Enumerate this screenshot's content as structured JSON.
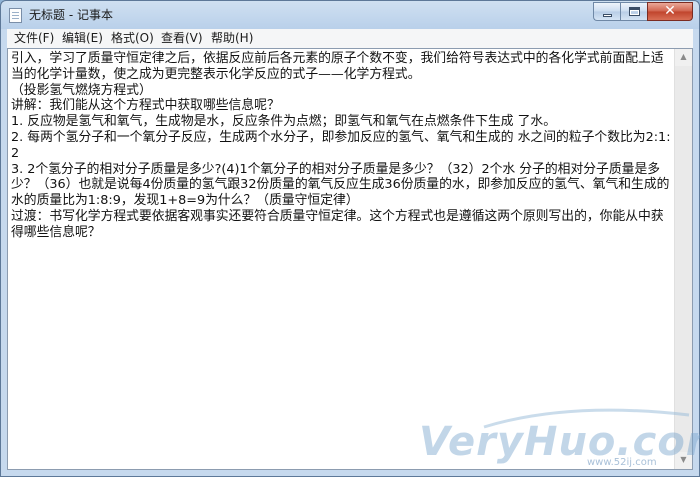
{
  "window": {
    "title": "无标题 - 记事本",
    "close_glyph": "✕"
  },
  "menu": {
    "items": [
      {
        "label": "文件(F)"
      },
      {
        "label": "编辑(E)"
      },
      {
        "label": "格式(O)"
      },
      {
        "label": "查看(V)"
      },
      {
        "label": "帮助(H)"
      }
    ]
  },
  "document": {
    "text": "引入，学习了质量守恒定律之后，依据反应前后各元素的原子个数不变，我们给符号表达式中的各化学式前面配上适当的化学计量数，使之成为更完整表示化学反应的式子——化学方程式。\n（投影氢气燃烧方程式）\n讲解：我们能从这个方程式中获取哪些信息呢？\n1. 反应物是氢气和氧气，生成物是水，反应条件为点燃；即氢气和氧气在点燃条件下生成 了水。\n2. 每两个氢分子和一个氧分子反应，生成两个水分子，即参加反应的氢气、氧气和生成的 水之间的粒子个数比为2:1:2\n3. 2个氢分子的相对分子质量是多少?(4)1个氧分子的相对分子质量是多少？（32）2个水 分子的相对分子质量是多少？（36）也就是说每4份质量的氢气跟32份质量的氧气反应生成36份质量的水，即参加反应的氢气、氧气和生成的水的质量比为1:8:9，发现1+8=9为什么？（质量守恒定律）\n过渡：书写化学方程式要依据客观事实还要符合质量守恒定律。这个方程式也是遵循这两个原则写出的，你能从中获得哪些信息呢？"
  },
  "watermark": {
    "brand": "VeryHuo.com",
    "url": "www.52ij.com"
  },
  "colors": {
    "titlebar": "#b9d0ea",
    "close_button": "#c0432c",
    "text": "#111111"
  }
}
